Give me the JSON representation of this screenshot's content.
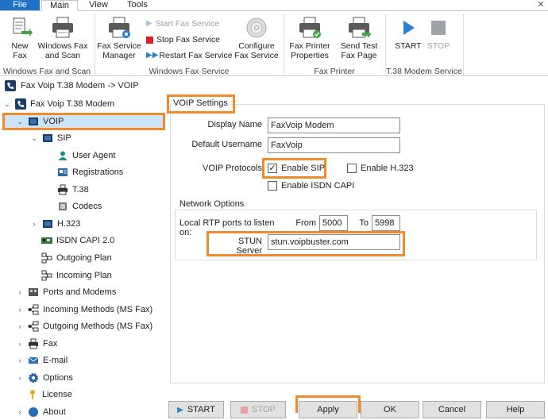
{
  "ribbon": {
    "tabs": [
      "File",
      "Main",
      "View",
      "Tools"
    ],
    "active_tab": "Main",
    "windows_fax_scan": {
      "new_fax": "New\nFax",
      "windows_fax_scan": "Windows Fax\nand Scan",
      "group_label": "Windows Fax and Scan"
    },
    "windows_fax_service": {
      "fax_service_manager": "Fax Service\nManager",
      "start_fax_service": "Start Fax Service",
      "stop_fax_service": "Stop Fax Service",
      "restart_fax_service": "Restart Fax Service",
      "configure_fax_service": "Configure\nFax Service",
      "group_label": "Windows Fax Service"
    },
    "fax_printer": {
      "fax_printer_properties": "Fax Printer\nProperties",
      "send_test_fax_page": "Send Test\nFax Page",
      "group_label": "Fax Printer"
    },
    "modem_service": {
      "start": "START",
      "stop": "STOP",
      "group_label": "T.38 Modem Service"
    }
  },
  "breadcrumb": "Fax Voip T.38 Modem -> VOIP",
  "tree": {
    "root": "Fax Voip T.38 Modem",
    "voip": "VOIP",
    "sip": "SIP",
    "user_agent": "User Agent",
    "registrations": "Registrations",
    "t38": "T.38",
    "codecs": "Codecs",
    "h323": "H.323",
    "isdn": "ISDN CAPI 2.0",
    "outgoing_plan": "Outgoing Plan",
    "incoming_plan": "Incoming Plan",
    "ports_modems": "Ports and Modems",
    "incoming_methods": "Incoming Methods (MS Fax)",
    "outgoing_methods": "Outgoing Methods (MS Fax)",
    "fax": "Fax",
    "email": "E-mail",
    "options": "Options",
    "license": "License",
    "about": "About"
  },
  "voip_settings": {
    "title": "VOIP Settings",
    "display_name_label": "Display Name",
    "display_name_value": "FaxVoip Modem",
    "default_username_label": "Default Username",
    "default_username_value": "FaxVoip",
    "protocols_label": "VOIP Protocols",
    "enable_sip": "Enable SIP",
    "enable_sip_checked": true,
    "enable_h323": "Enable H.323",
    "enable_h323_checked": false,
    "enable_isdn": "Enable ISDN CAPI",
    "enable_isdn_checked": false,
    "network_options_title": "Network Options",
    "rtp_label": "Local RTP ports to listen on:",
    "from_label": "From",
    "from_value": "5000",
    "to_label": "To",
    "to_value": "5998",
    "stun_label": "STUN Server",
    "stun_value": "stun.voipbuster.com"
  },
  "buttons": {
    "start": "START",
    "stop": "STOP",
    "apply": "Apply",
    "ok": "OK",
    "cancel": "Cancel",
    "help": "Help"
  },
  "colors": {
    "accent": "#1e73c9",
    "highlight": "#f08a2c",
    "selection": "#cce4f7"
  }
}
